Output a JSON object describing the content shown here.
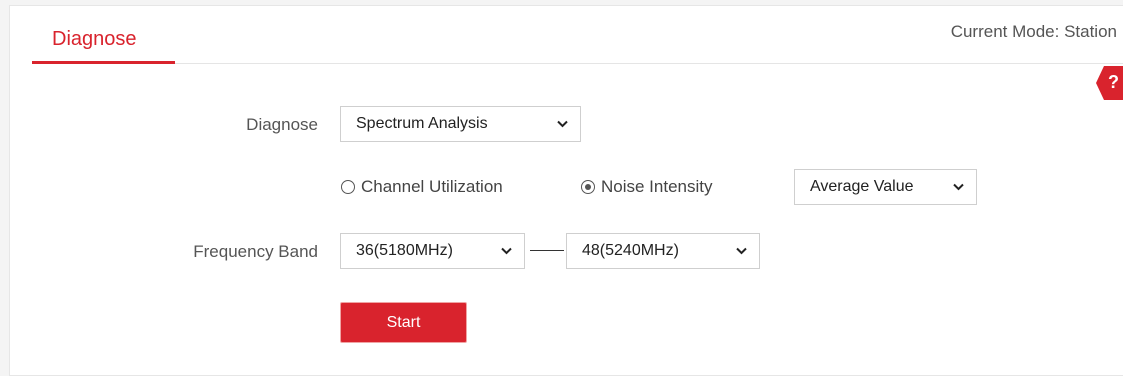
{
  "tab": {
    "label": "Diagnose"
  },
  "mode": {
    "text": "Current Mode: Station"
  },
  "help": {
    "glyph": "?"
  },
  "diagnose": {
    "label": "Diagnose",
    "selected": "Spectrum Analysis"
  },
  "metric": {
    "options": [
      {
        "label": "Channel Utilization",
        "checked": false
      },
      {
        "label": "Noise Intensity",
        "checked": true
      }
    ],
    "value_type": "Average Value"
  },
  "frequency_band": {
    "label": "Frequency Band",
    "from": "36(5180MHz)",
    "to": "48(5240MHz)"
  },
  "start_button": {
    "label": "Start"
  },
  "colors": {
    "accent": "#d9232d",
    "text": "#555555",
    "border": "#cfcfcf"
  },
  "icons": {
    "dropdown": "chevron-down-icon",
    "help": "question-icon"
  }
}
